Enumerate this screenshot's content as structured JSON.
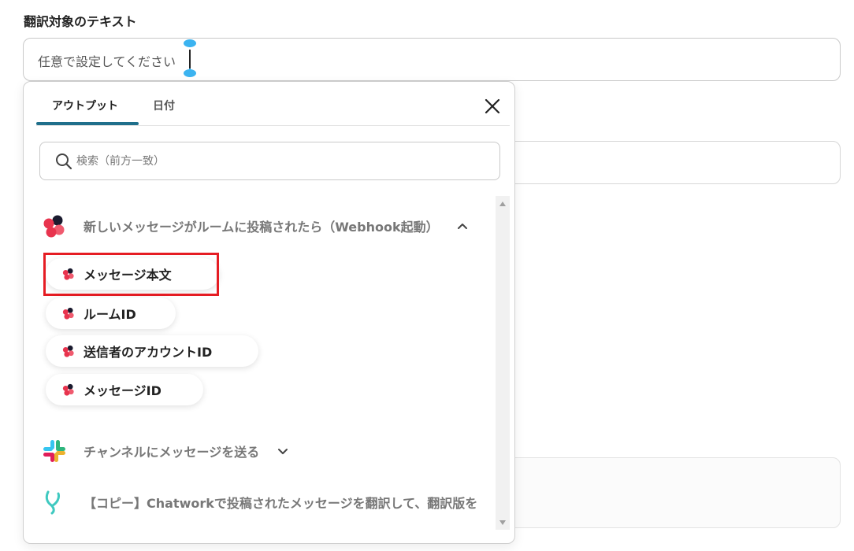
{
  "field": {
    "label": "翻訳対象のテキスト",
    "placeholder": "任意で設定してください"
  },
  "popup": {
    "tabs": [
      {
        "label": "アウトプット"
      },
      {
        "label": "日付"
      }
    ],
    "search_placeholder": "検索（前方一致）",
    "sections": [
      {
        "title": "新しいメッセージがルームに投稿されたら（Webhook起動）",
        "icon": "chatwork-icon",
        "expanded": true,
        "items": [
          {
            "label": "メッセージ本文",
            "highlighted": true
          },
          {
            "label": "ルームID"
          },
          {
            "label": "送信者のアカウントID"
          },
          {
            "label": "メッセージID"
          }
        ]
      },
      {
        "title": "チャンネルにメッセージを送る",
        "icon": "slack-icon",
        "expanded": false
      },
      {
        "title": "【コピー】Chatworkで投稿されたメッセージを翻訳して、翻訳版を",
        "icon": "yoom-icon"
      }
    ]
  },
  "colors": {
    "accent": "#1f6f8b",
    "highlight": "#e51c23",
    "cursor_handle": "#3bb3f0"
  }
}
